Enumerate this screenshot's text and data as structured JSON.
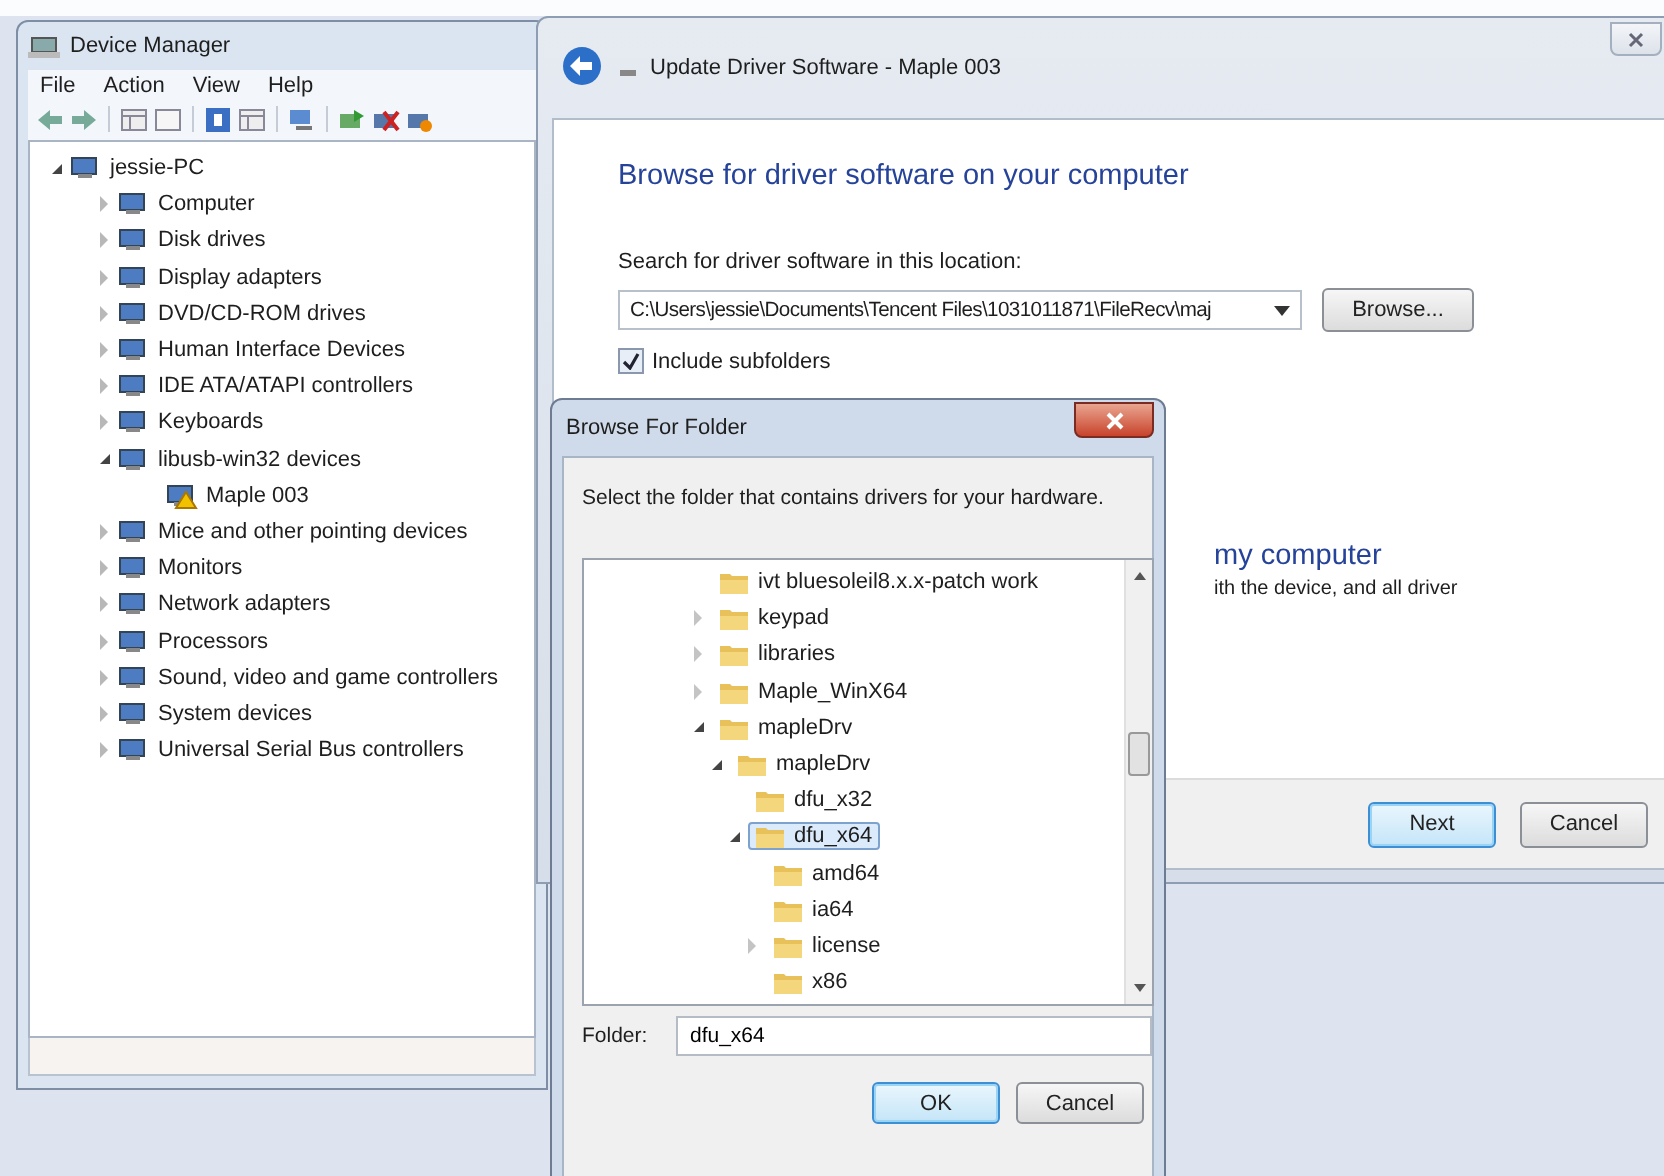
{
  "device_manager": {
    "title": "Device Manager",
    "menu": [
      "File",
      "Action",
      "View",
      "Help"
    ],
    "tree": [
      {
        "label": "jessie-PC",
        "kind": "expanded",
        "warning": false,
        "children": [
          {
            "label": "Computer",
            "kind": "collapsed",
            "warning": false
          },
          {
            "label": "Disk drives",
            "kind": "collapsed",
            "warning": false
          },
          {
            "label": "Display adapters",
            "kind": "collapsed",
            "warning": false
          },
          {
            "label": "DVD/CD-ROM drives",
            "kind": "collapsed",
            "warning": false
          },
          {
            "label": "Human Interface Devices",
            "kind": "collapsed",
            "warning": false
          },
          {
            "label": "IDE ATA/ATAPI controllers",
            "kind": "collapsed",
            "warning": false
          },
          {
            "label": "Keyboards",
            "kind": "collapsed",
            "warning": false
          },
          {
            "label": "libusb-win32 devices",
            "kind": "expanded",
            "warning": false,
            "children": [
              {
                "label": "Maple 003",
                "warning": true
              }
            ]
          },
          {
            "label": "Mice and other pointing devices",
            "kind": "collapsed",
            "warning": false
          },
          {
            "label": "Monitors",
            "kind": "collapsed",
            "warning": false
          },
          {
            "label": "Network adapters",
            "kind": "collapsed",
            "warning": false
          },
          {
            "label": "Processors",
            "kind": "collapsed",
            "warning": false
          },
          {
            "label": "Sound, video and game controllers",
            "kind": "collapsed",
            "warning": false
          },
          {
            "label": "System devices",
            "kind": "collapsed",
            "warning": false
          },
          {
            "label": "Universal Serial Bus controllers",
            "kind": "collapsed",
            "warning": false
          }
        ]
      }
    ]
  },
  "update_driver": {
    "title": "Update Driver Software - Maple 003",
    "heading": "Browse for driver software on your computer",
    "location_label": "Search for driver software in this location:",
    "location_value": "C:\\Users\\jessie\\Documents\\Tencent Files\\1031011871\\FileRecv\\maj",
    "browse_button": "Browse...",
    "include_subfolders": {
      "label": "Include subfolders",
      "checked": true
    },
    "option_title": "my computer",
    "option_text": "ith the device, and all driver",
    "buttons": [
      "Next",
      "Cancel"
    ]
  },
  "browse_folder": {
    "title": "Browse For Folder",
    "instruction": "Select the folder that contains drivers for your hardware.",
    "tree": [
      {
        "label": "ivt bluesoleil8.x.x-patch work",
        "selected": false
      },
      {
        "label": "keypad",
        "kind": "collapsed",
        "selected": false
      },
      {
        "label": "libraries",
        "kind": "collapsed",
        "selected": false
      },
      {
        "label": "Maple_WinX64",
        "kind": "collapsed",
        "selected": false
      },
      {
        "label": "mapleDrv",
        "kind": "expanded",
        "selected": false,
        "children": [
          {
            "label": "mapleDrv",
            "kind": "expanded",
            "selected": false,
            "children": [
              {
                "label": "dfu_x32",
                "selected": false
              },
              {
                "label": "dfu_x64",
                "kind": "expanded",
                "selected": true,
                "children": [
                  {
                    "label": "amd64",
                    "selected": false
                  },
                  {
                    "label": "ia64",
                    "selected": false
                  },
                  {
                    "label": "license",
                    "kind": "collapsed",
                    "selected": false
                  },
                  {
                    "label": "x86",
                    "selected": false
                  }
                ]
              }
            ]
          }
        ]
      }
    ],
    "folder_label": "Folder:",
    "folder_value": "dfu_x64",
    "buttons": [
      "OK",
      "Cancel"
    ]
  }
}
